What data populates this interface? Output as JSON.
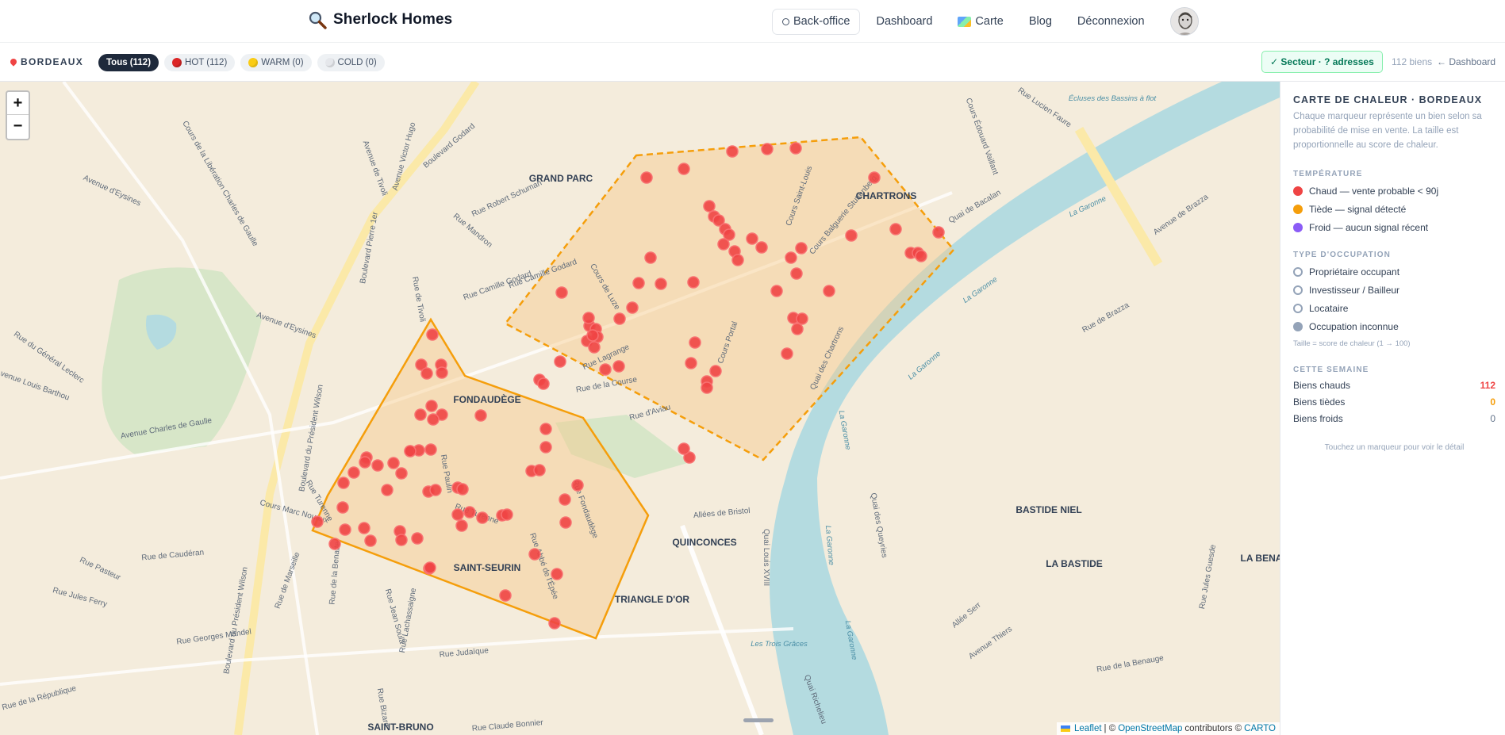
{
  "app": {
    "title": "Sherlock Homes",
    "icon": "magnifier-icon"
  },
  "nav": {
    "backoffice": "Back-office",
    "dashboard": "Dashboard",
    "carte": "Carte",
    "blog": "Blog",
    "logout": "Déconnexion"
  },
  "filters": {
    "city": "BORDEAUX",
    "all": "Tous (112)",
    "hot": "HOT (112)",
    "warm": "WARM (0)",
    "cold": "COLD (0)",
    "sector": "✓ Secteur · ? adresses",
    "count": "112 biens",
    "dashboard_link": "← Dashboard"
  },
  "map": {
    "zoom_in": "+",
    "zoom_out": "−",
    "districts": [
      "GRAND PARC",
      "CHARTRONS",
      "FONDAUDÈGE",
      "SAINT-SEURIN",
      "TRIANGLE D'OR",
      "QUINCONCES",
      "BASTIDE NIEL",
      "LA BASTIDE",
      "LA BENA",
      "SAINT-BRUNO"
    ],
    "streets": [
      "Boulevard Godard",
      "Avenue Victor Hugo",
      "Cours de la Libération Charles de Gaulle",
      "Avenue d'Eysines",
      "Avenue de Tivoli",
      "Boulevard Pierre 1er",
      "Rue Robert Schuman",
      "Rue Mandron",
      "Rue Camille Godard",
      "Rue de Tivoli",
      "Avenue d'Eysines",
      "Rue du Général Leclerc",
      "Avenue Louis Barthou",
      "Boulevard du Président Wilson",
      "Avenue Charles de Gaulle",
      "Rue Turenne",
      "Cours Marc Nouaux",
      "Rue de Caudéran",
      "Rue Pasteur",
      "Rue Jules Ferry",
      "Rue Georges Mandel",
      "Rue Judaïque",
      "Rue de la République",
      "Rue Bizard",
      "Rue Claude Bonnier",
      "Cours Portal",
      "Cours Saint-Louis",
      "Cours Balguerie Stuttenberg",
      "Quai des Chartrons",
      "Quai de Bacalan",
      "Cours Édouard Vaillant",
      "Rue Lucien Faure",
      "Quai Louis XVIII",
      "Allées de Bristol",
      "Rue d'Aviau",
      "Rue Fondaudège",
      "Rue Abbé de l'Épée",
      "Rue Turenne",
      "Rue Paulin",
      "Rue Lagrange",
      "Cours de Luze",
      "Quai des Queyries",
      "Rue de Brazza",
      "Avenue de Brazza",
      "Rue de la Benauge",
      "Avenue Thiers",
      "Allée Serr",
      "Rue Jules Guesde",
      "Quai Richelieu",
      "Rue Lachassaigne",
      "Rue de la Benatte",
      "Rue Jean Soula",
      "Rue de Marseille",
      "Boulevard du Président Wilson",
      "Rue Camille Godard",
      "Rue de la Course"
    ],
    "water_labels": [
      "La Garonne",
      "La Garonne",
      "La Garonne",
      "La Garonne",
      "La Garonne",
      "La Garonne",
      "Écluses des Bassins à flot",
      "Les Trois Grâces"
    ],
    "attribution": {
      "leaflet": "Leaflet",
      "sep": " | © ",
      "osm": "OpenStreetMap",
      "contrib": " contributors © ",
      "carto": "CARTO"
    }
  },
  "panel": {
    "title": "CARTE DE CHALEUR · BORDEAUX",
    "description": "Chaque marqueur représente un bien selon sa probabilité de mise en vente. La taille est proportionnelle au score de chaleur.",
    "temperature_title": "TEMPÉRATURE",
    "temperature": [
      {
        "label": "Chaud — vente probable < 90j",
        "color": "#ef4444"
      },
      {
        "label": "Tiède — signal détecté",
        "color": "#f59e0b"
      },
      {
        "label": "Froid — aucun signal récent",
        "color": "#8b5cf6"
      }
    ],
    "occupancy_title": "TYPE D'OCCUPATION",
    "occupancy": [
      {
        "label": "Propriétaire occupant"
      },
      {
        "label": "Investisseur / Bailleur"
      },
      {
        "label": "Locataire"
      },
      {
        "label": "Occupation inconnue"
      }
    ],
    "size_note": "Taille = score de chaleur (1 → 100)",
    "week_title": "CETTE SEMAINE",
    "week": [
      {
        "label": "Biens chauds",
        "value": "112",
        "color": "#ef4444"
      },
      {
        "label": "Biens tièdes",
        "value": "0",
        "color": "#f59e0b"
      },
      {
        "label": "Biens froids",
        "value": "0",
        "color": "#64748b"
      }
    ],
    "hint": "Touchez un marqueur pour voir le détail"
  },
  "colors": {
    "hot": "#ef4444",
    "zone_stroke": "#f59e0b",
    "zone_fill": "#f7c98a",
    "water": "#b4dbe0",
    "park": "#d7e6c8"
  }
}
